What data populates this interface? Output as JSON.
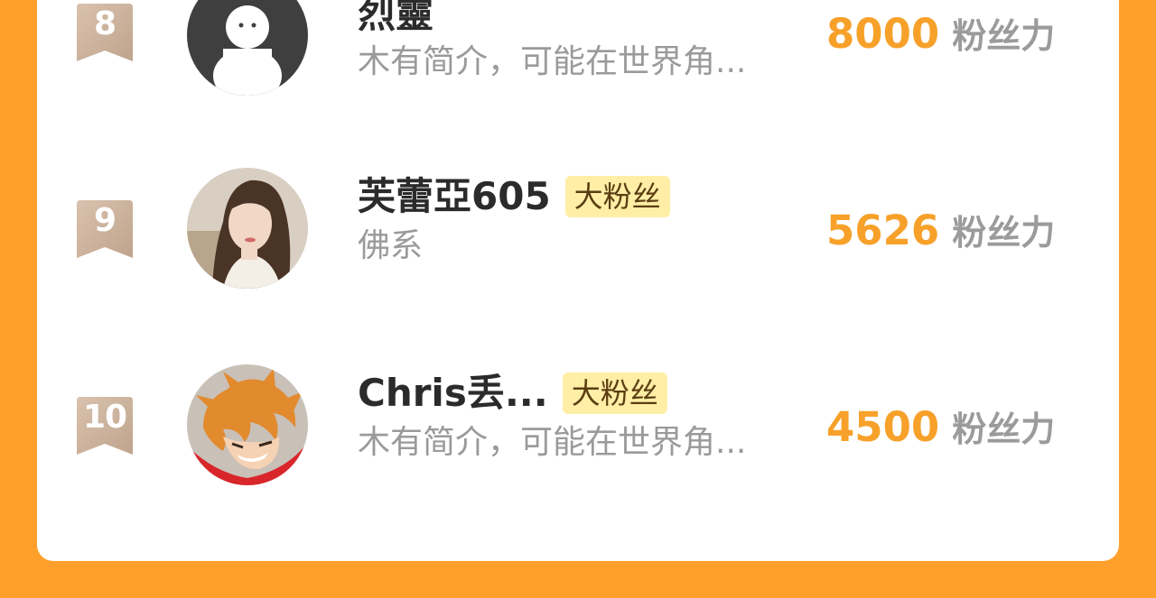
{
  "colors": {
    "page_background": "#FFA02C",
    "card_background": "#FFFFFF",
    "score": "#F7A12A",
    "badge_background": "#FFEEA6",
    "rank_badge": "#CDB19A"
  },
  "leaderboard": {
    "rows": [
      {
        "rank": "8",
        "avatar": "default-avatar-icon",
        "name": "烈靈",
        "badge": "",
        "bio": "木有简介，可能在世界角...",
        "score": "8000",
        "score_unit": "粉丝力"
      },
      {
        "rank": "9",
        "avatar": "user-photo-avatar",
        "name": "芙蕾亞605",
        "badge": "大粉丝",
        "bio": "佛系",
        "score": "5626",
        "score_unit": "粉丝力"
      },
      {
        "rank": "10",
        "avatar": "anime-character-avatar",
        "name": "Chris丢...",
        "badge": "大粉丝",
        "bio": "木有简介，可能在世界角...",
        "score": "4500",
        "score_unit": "粉丝力"
      }
    ]
  }
}
